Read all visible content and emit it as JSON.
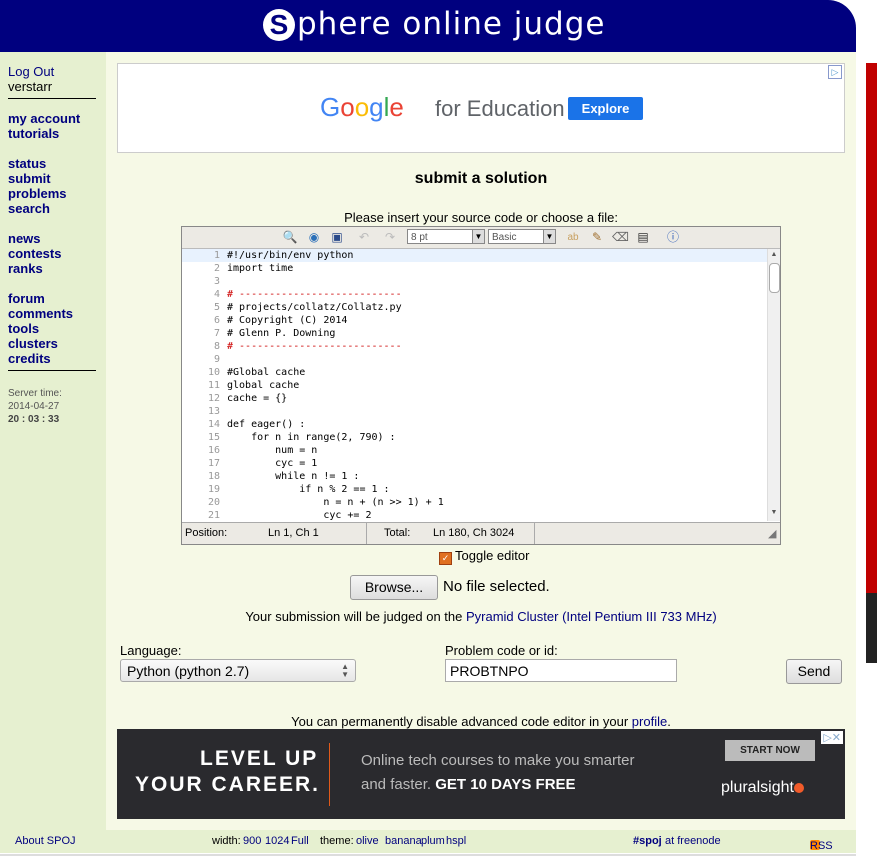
{
  "brand": {
    "logo_letter": "S",
    "title": "phere online judge"
  },
  "colors": {
    "banner": "#00007f",
    "sidebar": "#e6f0d0",
    "main_bg": "#f6f9e6",
    "link": "#00007f"
  },
  "nav": {
    "logout": "Log Out",
    "username": "verstarr",
    "group1": [
      "my account",
      "tutorials"
    ],
    "group2": [
      "status",
      "submit",
      "problems",
      "search"
    ],
    "group3": [
      "news",
      "contests",
      "ranks"
    ],
    "group4": [
      "forum",
      "comments",
      "tools",
      "clusters",
      "credits"
    ]
  },
  "server": {
    "label": "Server time:",
    "date": "2014-04-27",
    "time": "20 : 03 : 33"
  },
  "ad_top": {
    "brand": "Google",
    "suffix": "for Education",
    "button": "Explore"
  },
  "page": {
    "heading": "submit a solution",
    "insert_prompt": "Please insert your source code or choose a file:"
  },
  "editor": {
    "font_size": "8 pt",
    "syntax": "Basic",
    "status": {
      "position_label": "Position:",
      "position_value": "Ln 1, Ch 1",
      "total_label": "Total:",
      "total_value": "Ln 180, Ch 3024"
    },
    "lines": [
      "#!/usr/bin/env python",
      "import time",
      "",
      "# ---------------------------",
      "# projects/collatz/Collatz.py",
      "# Copyright (C) 2014",
      "# Glenn P. Downing",
      "# ---------------------------",
      "",
      "#Global cache",
      "global cache",
      "cache = {}",
      "",
      "def eager() :",
      "    for n in range(2, 790) :",
      "        num = n",
      "        cyc = 1",
      "        while n != 1 :",
      "            if n % 2 == 1 :",
      "                n = n + (n >> 1) + 1",
      "                cyc += 2"
    ]
  },
  "toggle_editor": "Toggle editor",
  "file": {
    "browse": "Browse...",
    "status": "No file selected."
  },
  "judged": {
    "prefix": "Your submission will be judged on the",
    "cluster": "Pyramid Cluster (Intel Pentium III 733 MHz)"
  },
  "form": {
    "language_label": "Language:",
    "language_value": "Python (python 2.7)",
    "problem_label": "Problem code or id:",
    "problem_value": "PROBTNPO",
    "send": "Send"
  },
  "disable_note": {
    "text": "You can permanently disable advanced code editor in your",
    "link": "profile",
    "end": "."
  },
  "ad_bottom": {
    "line1": "LEVEL UP",
    "line2": "YOUR CAREER.",
    "text1": "Online tech courses to make you smarter",
    "text2_pre": "and faster.",
    "text2_bold": "GET 10 DAYS FREE",
    "button": "START NOW",
    "brand": "pluralsight"
  },
  "footer": {
    "about": "About SPOJ",
    "width_label": "width:",
    "width_900": "900",
    "width_1024": "1024",
    "width_full": "Full",
    "theme_label": "theme:",
    "themes": [
      "olive",
      "banana",
      "plum",
      "hspl"
    ],
    "channel": "#spoj",
    "network": "at freenode",
    "rss": "RSS"
  }
}
